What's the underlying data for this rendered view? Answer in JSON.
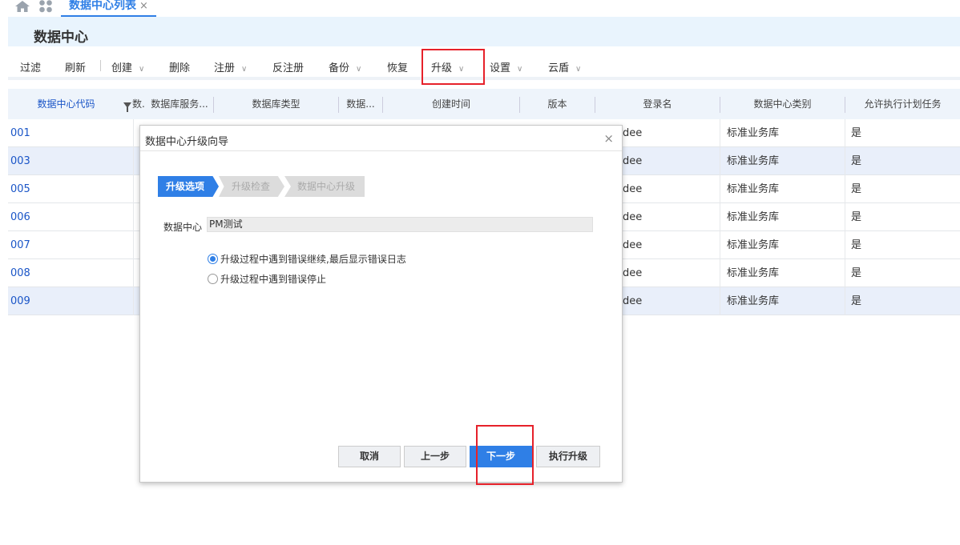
{
  "tabbar": {
    "tab_label": "数据中心列表",
    "close_glyph": "×"
  },
  "header": {
    "title": "数据中心"
  },
  "toolbar": {
    "items": [
      {
        "label": "过滤",
        "dropdown": false
      },
      {
        "label": "刷新",
        "dropdown": false
      },
      {
        "label": "创建",
        "dropdown": true
      },
      {
        "label": "删除",
        "dropdown": false
      },
      {
        "label": "注册",
        "dropdown": true
      },
      {
        "label": "反注册",
        "dropdown": false
      },
      {
        "label": "备份",
        "dropdown": true
      },
      {
        "label": "恢复",
        "dropdown": false
      },
      {
        "label": "升级",
        "dropdown": true
      },
      {
        "label": "设置",
        "dropdown": true
      },
      {
        "label": "云盾",
        "dropdown": true
      }
    ]
  },
  "grid": {
    "columns": [
      "数据中心代码",
      "数...",
      "数据库服务...",
      "数据库类型",
      "数据...",
      "创建时间",
      "版本",
      "登录名",
      "数据中心类别",
      "允许执行计划任务"
    ],
    "rows": [
      {
        "code": "001",
        "login": "dee",
        "type": "标准业务库",
        "allow": "是"
      },
      {
        "code": "003",
        "login": "dee",
        "type": "标准业务库",
        "allow": "是"
      },
      {
        "code": "005",
        "login": "dee",
        "type": "标准业务库",
        "allow": "是"
      },
      {
        "code": "006",
        "login": "dee",
        "type": "标准业务库",
        "allow": "是"
      },
      {
        "code": "007",
        "login": "dee",
        "type": "标准业务库",
        "allow": "是"
      },
      {
        "code": "008",
        "login": "dee",
        "type": "标准业务库",
        "allow": "是"
      },
      {
        "code": "009",
        "login": "dee",
        "type": "标准业务库",
        "allow": "是"
      }
    ]
  },
  "dialog": {
    "title": "数据中心升级向导",
    "close_glyph": "×",
    "steps": [
      "升级选项",
      "升级检查",
      "数据中心升级"
    ],
    "dc_label": "数据中心",
    "dc_value": "PM测试",
    "options": [
      {
        "label": "升级过程中遇到错误继续,最后显示错误日志",
        "selected": true
      },
      {
        "label": "升级过程中遇到错误停止",
        "selected": false
      }
    ],
    "buttons": {
      "cancel": "取消",
      "prev": "上一步",
      "next": "下一步",
      "execute": "执行升级"
    }
  },
  "colors": {
    "accent": "#2f7fe6",
    "highlight": "#e6212a",
    "link": "#1a55c7"
  }
}
